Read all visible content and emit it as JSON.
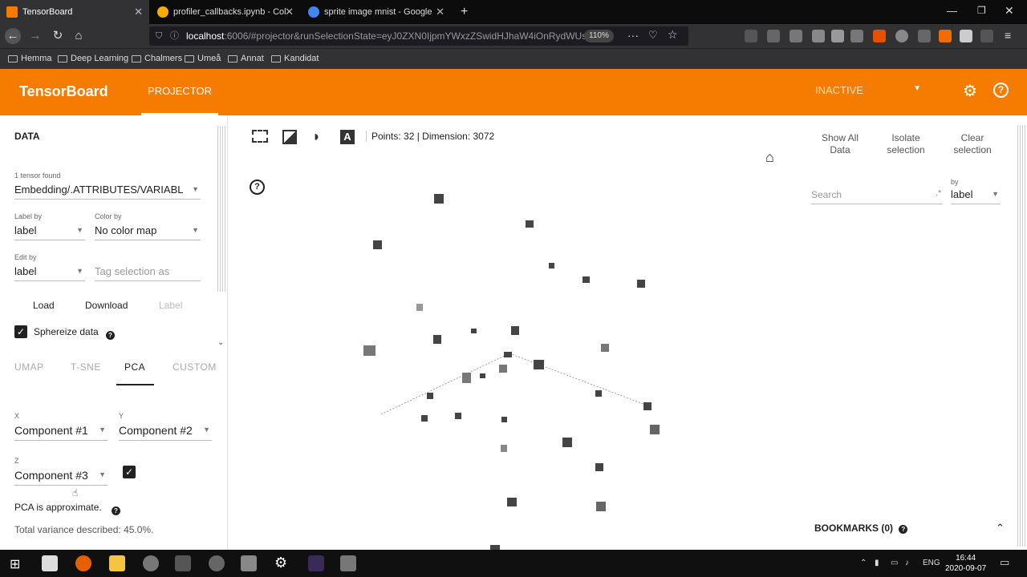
{
  "browser": {
    "tabs": [
      {
        "title": "TensorBoard",
        "active": true
      },
      {
        "title": "profiler_callbacks.ipynb - Col",
        "active": false
      },
      {
        "title": "sprite image mnist - Google",
        "active": false
      }
    ],
    "new_tab": "+",
    "url_host": "localhost",
    "url_rest": ":6006/#projector&runSelectionState=eyJ0ZXN0IjpmYWxzZSwidHJhaW4iOnRydWUsIn",
    "zoom": "110%",
    "bookmarks": [
      "Hemma",
      "Deep Learning",
      "Chalmers",
      "Umeå",
      "Annat",
      "Kandidat"
    ]
  },
  "header": {
    "logo": "TensorBoard",
    "tab": "PROJECTOR",
    "run_select": "INACTIVE"
  },
  "left_panel": {
    "title": "DATA",
    "tensor_found": "1 tensor found",
    "tensor": "Embedding/.ATTRIBUTES/VARIABL",
    "label_by_label": "Label by",
    "label_by": "label",
    "color_by_label": "Color by",
    "color_by": "No color map",
    "edit_by_label": "Edit by",
    "edit_by": "label",
    "tag_placeholder": "Tag selection as",
    "load": "Load",
    "download": "Download",
    "label_btn": "Label",
    "sphereize": "Sphereize data",
    "tabs": [
      "UMAP",
      "T-SNE",
      "PCA",
      "CUSTOM"
    ],
    "x_label": "X",
    "x_value": "Component #1",
    "y_label": "Y",
    "y_value": "Component #2",
    "z_label": "Z",
    "z_value": "Component #3",
    "pca_note": "PCA is approximate.",
    "variance": "Total variance described: 45.0%."
  },
  "main": {
    "points_info": "Points: 32 | Dimension: 3072",
    "show_all": "Show All Data",
    "isolate": "Isolate selection",
    "clear": "Clear selection",
    "search_placeholder": "Search",
    "by_label": "by",
    "by_value": "label",
    "bookmarks": "BOOKMARKS (0)"
  },
  "taskbar": {
    "lang": "ENG",
    "time": "16:44",
    "date": "2020-09-07"
  }
}
